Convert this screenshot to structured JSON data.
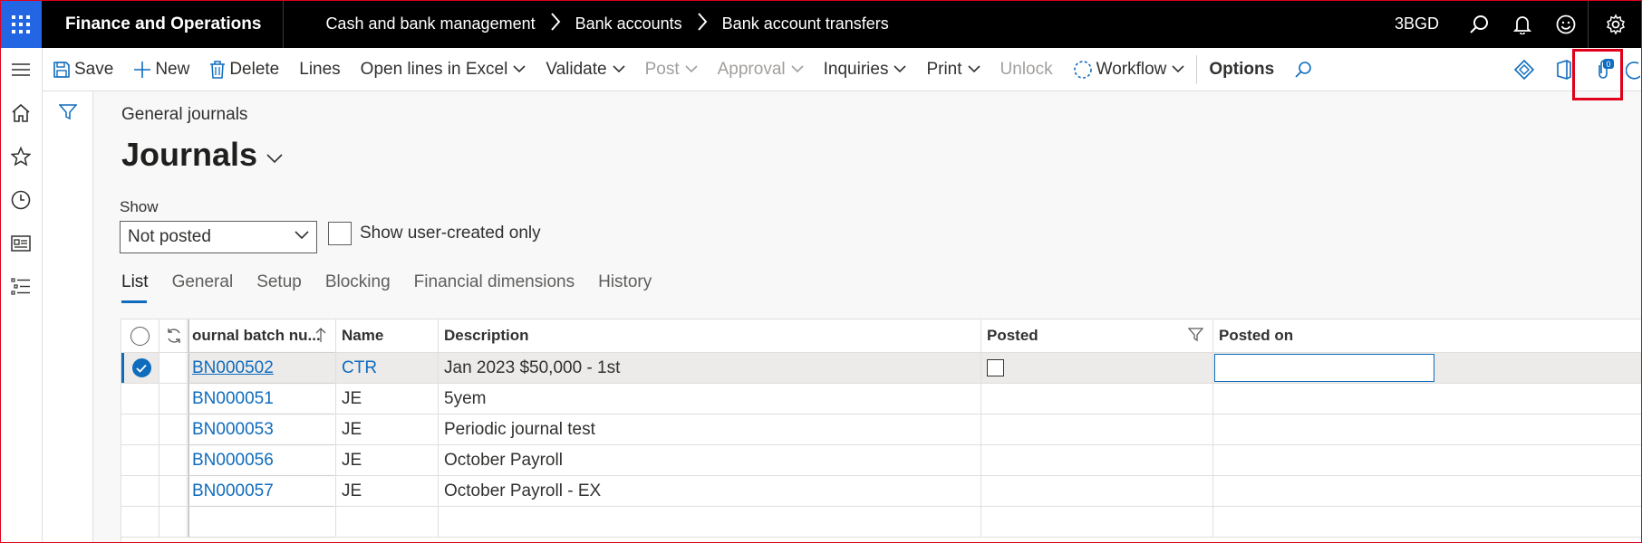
{
  "app": {
    "name": "Finance and Operations",
    "company": "3BGD"
  },
  "breadcrumb": [
    "Cash and bank management",
    "Bank accounts",
    "Bank account transfers"
  ],
  "actions": {
    "save": "Save",
    "new": "New",
    "delete": "Delete",
    "lines": "Lines",
    "open_in_excel": "Open lines in Excel",
    "validate": "Validate",
    "post": "Post",
    "approval": "Approval",
    "inquiries": "Inquiries",
    "print": "Print",
    "unlock": "Unlock",
    "workflow": "Workflow",
    "options": "Options",
    "attachment_count": "0"
  },
  "page": {
    "breadcrumb": "General journals",
    "title": "Journals"
  },
  "filters": {
    "show_label": "Show",
    "show_value": "Not posted",
    "user_created_label": "Show user-created only"
  },
  "tabs": [
    "List",
    "General",
    "Setup",
    "Blocking",
    "Financial dimensions",
    "History"
  ],
  "grid": {
    "columns": [
      "ournal batch nu...",
      "Name",
      "Description",
      "Posted",
      "Posted on"
    ],
    "rows": [
      {
        "batch": "BN000502",
        "name": "CTR",
        "description": "Jan 2023 $50,000 - 1st",
        "selected": true
      },
      {
        "batch": "BN000051",
        "name": "JE",
        "description": "5yem",
        "selected": false
      },
      {
        "batch": "BN000053",
        "name": "JE",
        "description": "Periodic journal test",
        "selected": false
      },
      {
        "batch": "BN000056",
        "name": "JE",
        "description": "October Payroll",
        "selected": false
      },
      {
        "batch": "BN000057",
        "name": "JE",
        "description": "October Payroll - EX",
        "selected": false
      }
    ]
  },
  "icons": {
    "waffle": "waffle-icon",
    "search": "search-icon",
    "bell": "bell-icon",
    "smiley": "smiley-icon",
    "gear": "gear-icon",
    "hamburger": "hamburger-icon",
    "home": "home-icon",
    "star": "star-icon",
    "clock": "clock-icon",
    "workspace": "workspace-icon",
    "list": "modules-icon"
  },
  "colors": {
    "accent": "#0f6cbd",
    "waffle": "#2266e3",
    "highlight": "#e0001b"
  }
}
